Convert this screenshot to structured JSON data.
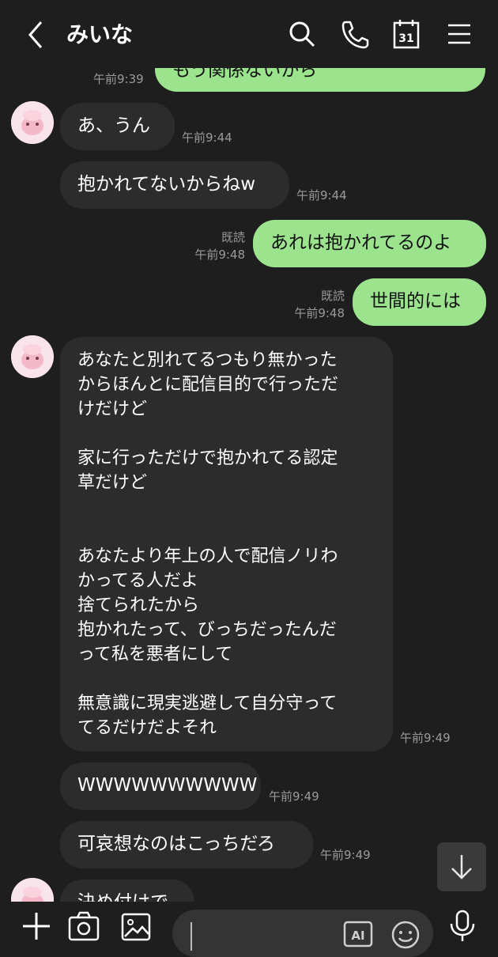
{
  "header": {
    "title": "みいな",
    "icons": [
      "back-chevron-icon",
      "search-icon",
      "phone-icon",
      "calendar-icon",
      "menu-icon"
    ],
    "calendar_day": "31"
  },
  "messages": {
    "m0": {
      "text": "もう関係ないから",
      "time": "午前9:39"
    },
    "m1": {
      "text": "あ、うん",
      "time": "午前9:44"
    },
    "m2": {
      "text": "抱かれてないからねw",
      "time": "午前9:44"
    },
    "m3": {
      "text": "あれは抱かれてるのよ",
      "read": "既読",
      "time": "午前9:48"
    },
    "m4": {
      "text": "世間的には",
      "read": "既読",
      "time": "午前9:48"
    },
    "m5": {
      "text": "あなたと別れてるつもり無かった\nからほんとに配信目的で行っただ\nけだけど\n\n家に行っただけで抱かれてる認定\n草だけど\n\n\nあなたより年上の人で配信ノリわ\nかってる人だよ\n捨てられたから\n抱かれたって、びっちだったんだ\nって私を悪者にして\n\n無意識に現実逃避して自分守って\nてるだけだよそれ",
      "time": "午前9:49"
    },
    "m6": {
      "text": "WWWWWWWWWW",
      "time": "午前9:49"
    },
    "m7": {
      "text": "可哀想なのはこっちだろ",
      "time": "午前9:49"
    },
    "m8": {
      "text": "決め付けで"
    }
  },
  "bottom": {
    "icons": [
      "plus-icon",
      "camera-icon",
      "image-icon",
      "ai-icon",
      "emoji-icon",
      "microphone-icon"
    ],
    "ai_label": "AI"
  },
  "colors": {
    "background": "#1e1e1e",
    "received_bubble": "#2c2c2c",
    "sent_bubble": "#9ce38e",
    "timestamp": "#9a9a9a"
  }
}
